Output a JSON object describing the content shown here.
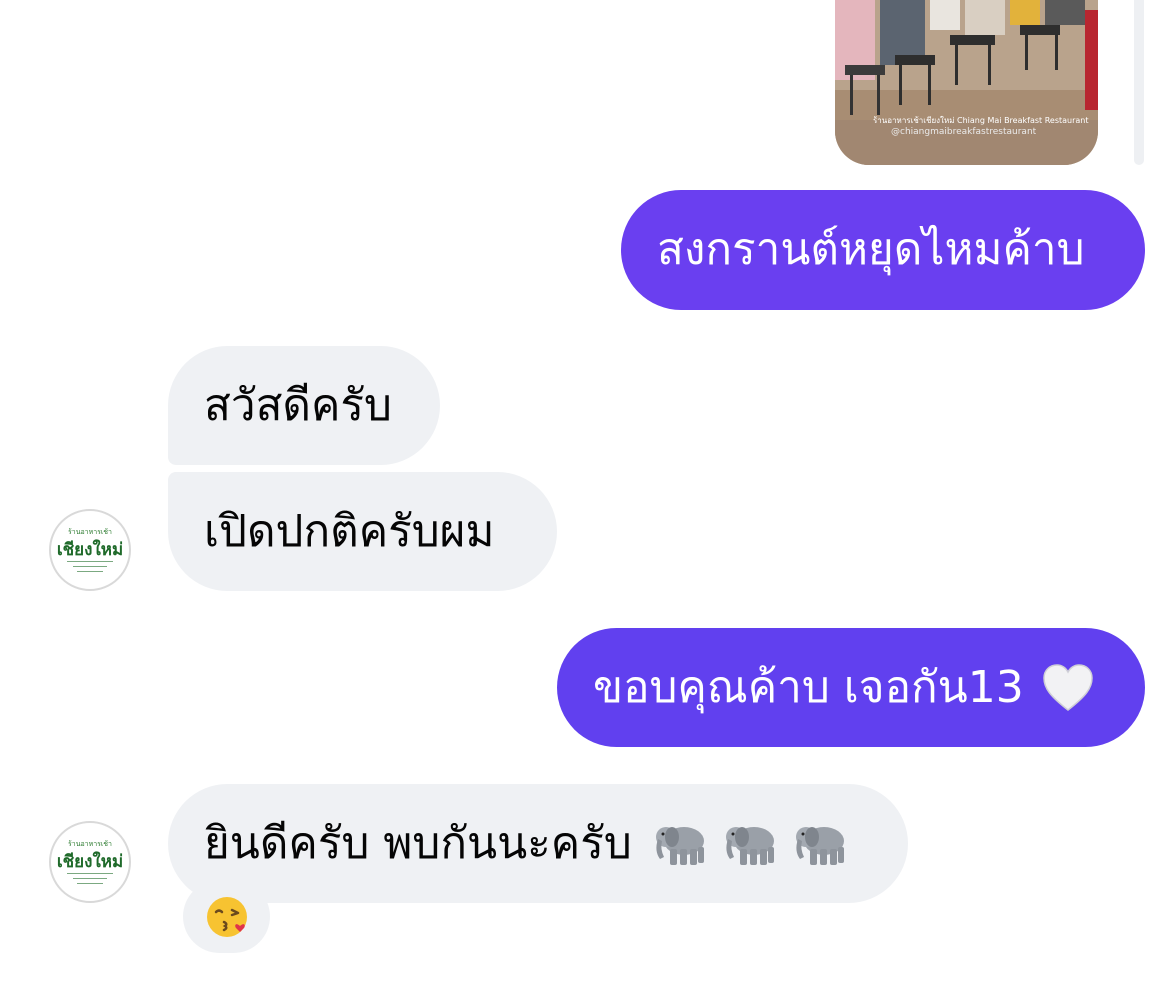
{
  "messages": {
    "sent_1": "สงกรานต์หยุดไหมค้าบ",
    "recv_1": "สวัสดีครับ",
    "recv_2": "เปิดปกติครับผม",
    "sent_2": "ขอบคุณค้าบ เจอกัน13",
    "recv_3": "ยินดีครับ พบกันนะครับ"
  },
  "shared_photo": {
    "location_caption": "ร้านอาหารเช้าเชียงใหม่ Chiang Mai Breakfast Restaurant",
    "handle_caption": "@chiangmaibreakfastrestaurant"
  },
  "avatar": {
    "logo_top": "ร้านอาหารเช้า",
    "logo_main": "เชียงใหม่"
  },
  "icons": {
    "heart": "white-heart-icon",
    "elephant": "elephant-icon",
    "kiss": "face-blowing-kiss-icon"
  },
  "emoji": {
    "kiss": "😘"
  },
  "colors": {
    "sent_bubble": "#6a3ff0",
    "received_bubble": "#eff1f4",
    "text_dark": "#050505"
  }
}
